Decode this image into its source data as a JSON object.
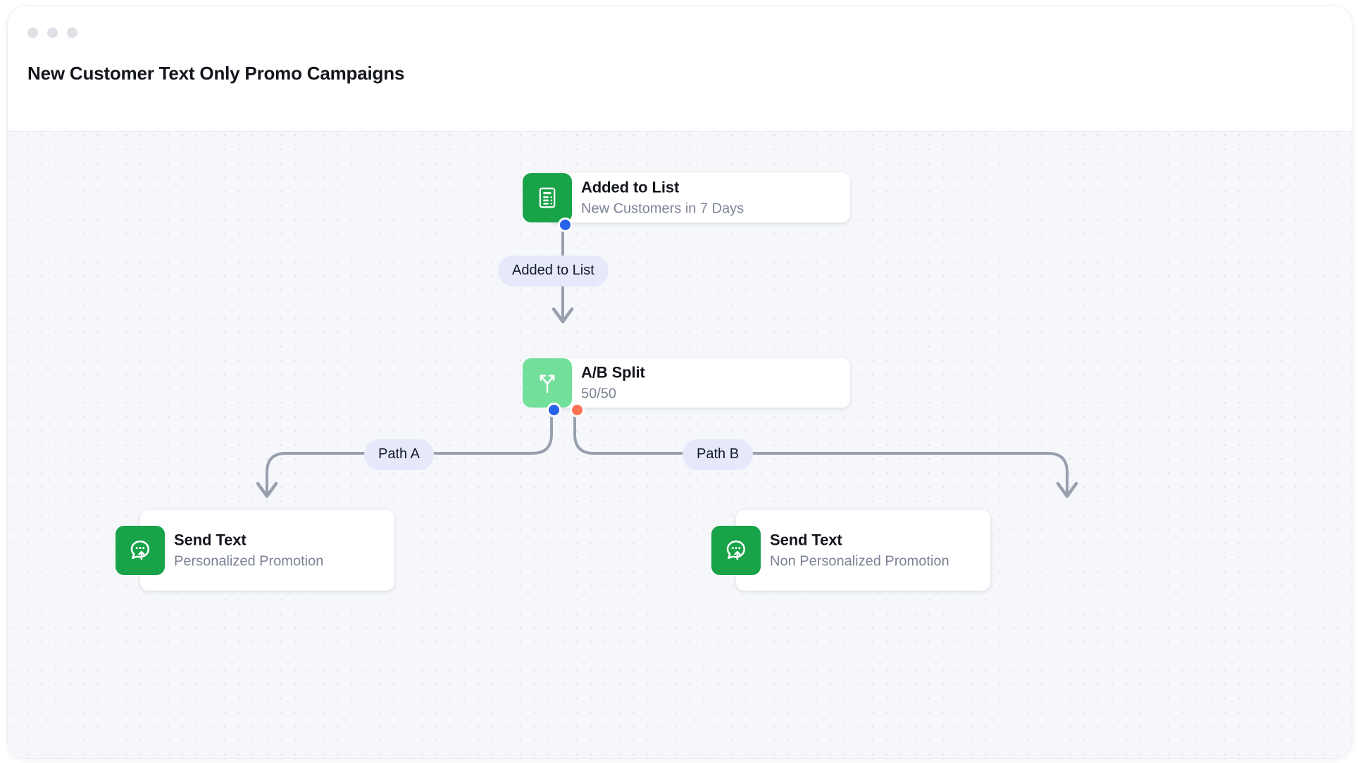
{
  "window": {
    "traffic_lights": [
      "close",
      "minimize",
      "maximize"
    ],
    "title": "New Customer Text Only Promo Campaigns"
  },
  "colors": {
    "canvas_bg": "#f5f7fa",
    "grid_dot": "#e3e5ec",
    "card_bg": "#ffffff",
    "card_border": "#eaecf0",
    "title_text": "#13161c",
    "sub_text": "#7b8394",
    "icon_green": "#19a349",
    "icon_green_light": "#72e09a",
    "edge_stroke": "#98a0ae",
    "edge_pill_bg": "#e6e9fb",
    "port_blue": "#2563eb",
    "port_orange": "#fb7352",
    "traffic_light": "#dfe1e7"
  },
  "flow": {
    "nodes": [
      {
        "id": "trigger",
        "title": "Added to List",
        "subtitle": "New Customers in 7 Days",
        "icon": "document-list-icon",
        "icon_bg": "#19a349"
      },
      {
        "id": "ab-split",
        "title": "A/B Split",
        "subtitle": "50/50",
        "icon": "split-branch-icon",
        "icon_bg": "#72e09a"
      },
      {
        "id": "send-text-a",
        "title": "Send Text",
        "subtitle": "Personalized Promotion",
        "icon": "chat-bubble-send-icon",
        "icon_bg": "#19a349"
      },
      {
        "id": "send-text-b",
        "title": "Send Text",
        "subtitle": "Non Personalized Promotion",
        "icon": "chat-bubble-send-icon",
        "icon_bg": "#19a349"
      }
    ],
    "edges": [
      {
        "id": "e1",
        "from": "trigger",
        "to": "ab-split",
        "label": "Added to List",
        "port_color": "#2563eb"
      },
      {
        "id": "e2",
        "from": "ab-split",
        "to": "send-text-a",
        "label": "Path A",
        "port_color": "#2563eb"
      },
      {
        "id": "e3",
        "from": "ab-split",
        "to": "send-text-b",
        "label": "Path B",
        "port_color": "#fb7352"
      }
    ]
  }
}
